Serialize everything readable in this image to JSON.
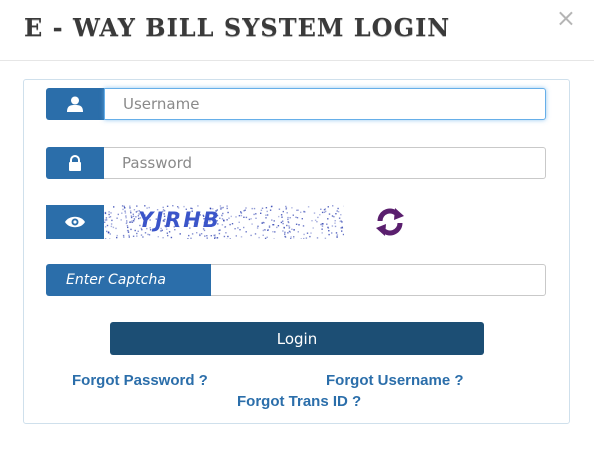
{
  "modal": {
    "title": "E - WAY BILL SYSTEM LOGIN",
    "close_label": "×"
  },
  "form": {
    "username": {
      "placeholder": "Username",
      "value": "",
      "icon": "user-icon"
    },
    "password": {
      "placeholder": "Password",
      "value": "",
      "icon": "lock-icon"
    },
    "captcha": {
      "image_text": "YJRHB",
      "eye_icon": "eye-icon",
      "refresh_icon": "refresh-icon",
      "input_label": "Enter Captcha",
      "input_value": ""
    },
    "login_label": "Login"
  },
  "links": {
    "forgot_password": "Forgot Password ?",
    "forgot_username": "Forgot Username ?",
    "forgot_trans_id": "Forgot Trans ID ?"
  },
  "colors": {
    "addon_blue": "#2b6eaa",
    "button_dark": "#1c4e74",
    "link_blue": "#2b6eaa",
    "refresh_purple": "#5a1f6e"
  }
}
